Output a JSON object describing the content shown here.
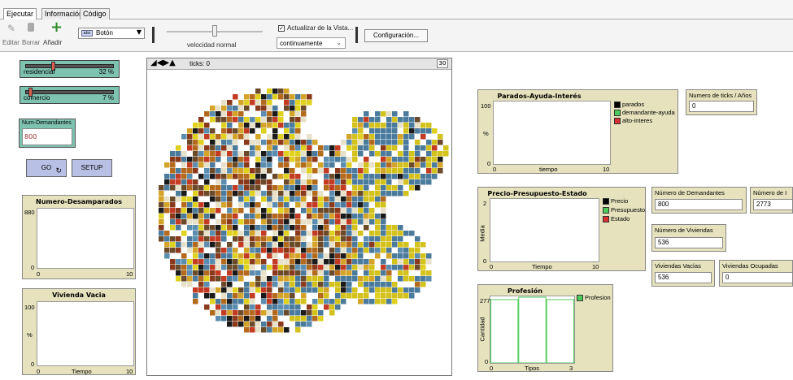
{
  "tabs": [
    "Ejecutar",
    "Información",
    "Código"
  ],
  "toolbar": {
    "edit_label": "Editar",
    "delete_label": "Borrar",
    "add_label": "Añadir",
    "widget_type": "Botón",
    "speed_label": "velocidad normal",
    "update_checkbox_label": "Actualizar de la Vista...",
    "update_mode": "continuamente",
    "config_label": "Configuración..."
  },
  "sliders": [
    {
      "label": "residencial",
      "value": "32 %",
      "fraction": 0.32
    },
    {
      "label": "comercio",
      "value": "7 %",
      "fraction": 0.07
    }
  ],
  "num_demandantes_input": {
    "label": "Num-Demandantes",
    "value": "800"
  },
  "buttons": {
    "go": "GO",
    "setup": "SETUP"
  },
  "view": {
    "ticks": "ticks: 0",
    "speed_box": "30"
  },
  "plots": {
    "desamparados": {
      "title": "Numero-Desamparados",
      "ymax": "880",
      "ymin": "0",
      "xmin": "0",
      "xmax": "10"
    },
    "vivienda_vacia": {
      "title": "Vivienda Vacia",
      "ymax": "100",
      "ymin": "0",
      "ylabel": "%",
      "xmin": "0",
      "xlabel": "Tiempo",
      "xmax": "10"
    },
    "parados": {
      "title": "Parados-Ayuda-Interés",
      "ymax": "100",
      "ymin": "0",
      "ylabel": "%",
      "xmin": "0",
      "xlabel": "tiempo",
      "xmax": "10",
      "legend": [
        {
          "name": "parados",
          "color": "#000000"
        },
        {
          "name": "demandante-ayuda",
          "color": "#4ecb5a"
        },
        {
          "name": "alto-interes",
          "color": "#d73030"
        }
      ]
    },
    "precio": {
      "title": "Precio-Presupuesto-Estado",
      "ymax": "2",
      "ymin": "0",
      "ylabel": "Media",
      "xmin": "0",
      "xlabel": "Tiempo",
      "xmax": "10",
      "legend": [
        {
          "name": "Precio",
          "color": "#000000"
        },
        {
          "name": "Presupuesto",
          "color": "#4ecb5a"
        },
        {
          "name": "Estado",
          "color": "#d73030"
        }
      ]
    },
    "profesion": {
      "title": "Profesión",
      "ymax": "277",
      "ymin": "0",
      "ylabel": "Cantidad",
      "xmin": "0",
      "xlabel": "Tipos",
      "xmax": "3",
      "legend": [
        {
          "name": "Profesion",
          "color": "#4ecb5a"
        }
      ],
      "bars": [
        277,
        277,
        277
      ]
    }
  },
  "monitors": {
    "ticks": {
      "label": "Numero de ticks / Años",
      "value": "0"
    },
    "demandantes": {
      "label": "Número de Demandantes",
      "value": "800"
    },
    "numero_r": {
      "label": "Número de I",
      "value": "2773"
    },
    "viviendas": {
      "label": "Número de Viviendas",
      "value": "536"
    },
    "vacias": {
      "label": "Viviendas Vacías",
      "value": "536"
    },
    "ocupadas": {
      "label": "Viviendas Ocupadas",
      "value": "0"
    }
  },
  "colors": {
    "slider": "#7ec2b0",
    "plot_bg": "#e5e2bd",
    "button": "#b8c0e6"
  }
}
